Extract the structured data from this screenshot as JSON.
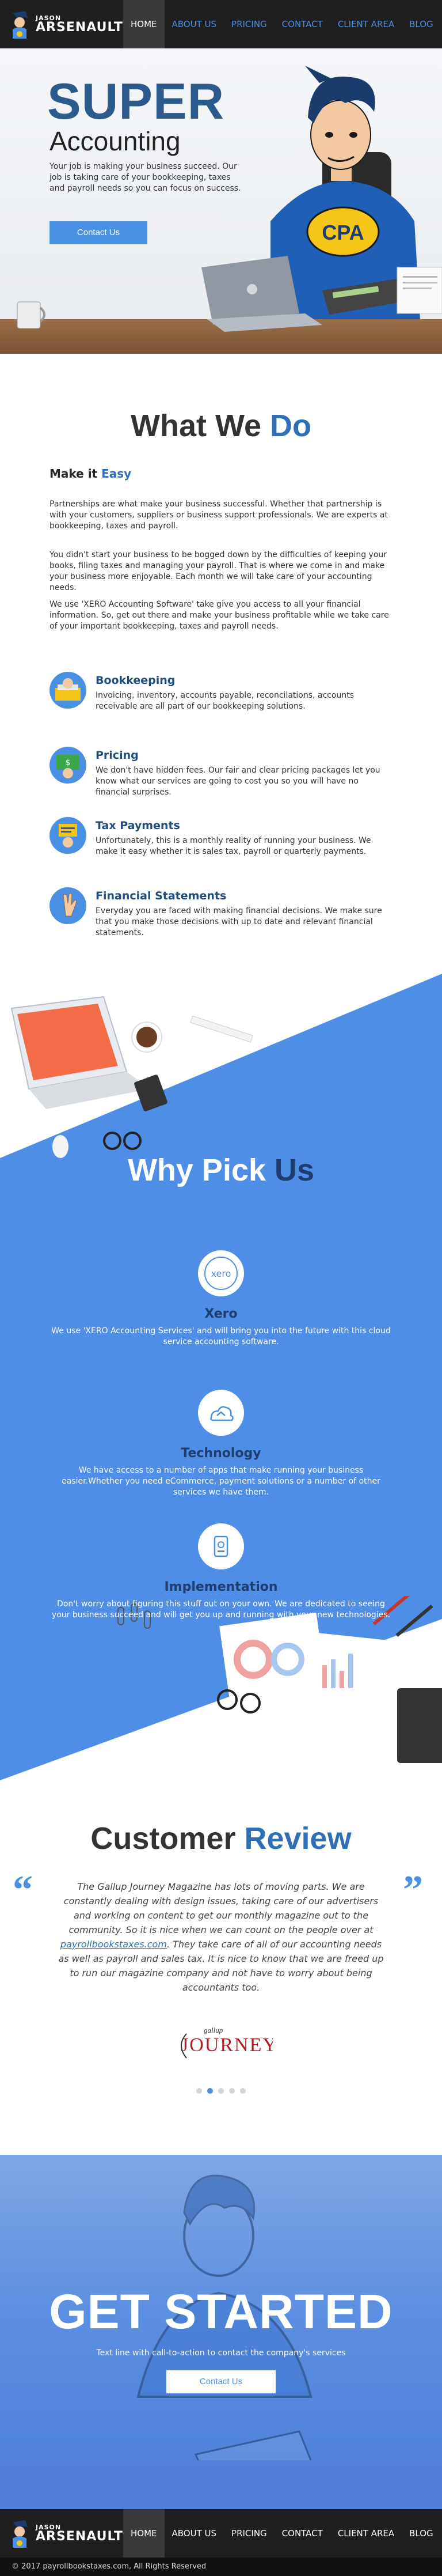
{
  "brand": {
    "line1": "JASON",
    "line2": "ARSENAULT"
  },
  "nav": {
    "items": [
      {
        "label": "HOME",
        "active": true
      },
      {
        "label": "ABOUT US",
        "active": false
      },
      {
        "label": "PRICING",
        "active": false
      },
      {
        "label": "CONTACT",
        "active": false
      },
      {
        "label": "CLIENT AREA",
        "active": false
      },
      {
        "label": "BLOG",
        "active": false
      }
    ]
  },
  "hero": {
    "title": "SUPER",
    "subtitle": "Accounting",
    "text": "Your job is making your business succeed. Our job is taking care of your bookkeeping, taxes and payroll needs so you can focus on success.",
    "cta": "Contact Us",
    "badge": "CPA"
  },
  "what_we_do": {
    "title_a": "What We ",
    "title_b": "Do",
    "sub_a": "Make it ",
    "sub_b": "Easy",
    "paragraphs": [
      "Partnerships are what make your business successful. Whether that partnership is with your customers, suppliers or business support professionals. We are experts at bookkeeping, taxes and payroll.",
      "You didn't start your business to be bogged down by the difficulties of keeping your books, filing taxes and managing your payroll. That is where we come in and make your business more enjoyable. Each month we will take care of your accounting needs.",
      "We use 'XERO Accounting Software' take give you access to all your financial information. So, get out there and make your business profitable while we take care of your important bookkeeping, taxes and payroll needs."
    ],
    "services": [
      {
        "title": "Bookkeeping",
        "text": "Invoicing, inventory, accounts payable, reconcilations, accounts receivable are all part of our bookkeeping solutions."
      },
      {
        "title": "Pricing",
        "text": "We don't have hidden fees. Our fair and clear pricing packages let you know what our services are going to cost you so you will have no financial surprises."
      },
      {
        "title": "Tax Payments",
        "text": "Unfortunately, this is a monthly reality of running your business. We make it easy whether it is sales tax, payroll or quarterly payments."
      },
      {
        "title": "Financial Statements",
        "text": "Everyday you are faced with making financial decisions. We make sure that you make those decisions with up to date and relevant financial statements."
      }
    ]
  },
  "why_pick_us": {
    "title_a": "Why Pick ",
    "title_b": "Us",
    "items": [
      {
        "title": "Xero",
        "text": "We use 'XERO Accounting Services' and will bring you into the future with this cloud service accounting software.",
        "icon_label": "xero"
      },
      {
        "title": "Technology",
        "text": "We have access to a number of apps that make running your business easier.Whether you need eCommerce, payment solutions or a number of other services we have them."
      },
      {
        "title": "Implementation",
        "text": "Don't worry about figuring this stuff out on your own. We are dedicated to seeing your business succeed and will get you up and running with your new technologies."
      }
    ]
  },
  "review": {
    "title_a": "Customer ",
    "title_b": "Review",
    "text_before": "The Gallup Journey Magazine has lots of moving parts. We are constantly dealing with design issues, taking care of our advertisers and working on content to get our monthly magazine out to the community. So it is nice when we can count on the people over at ",
    "link": "payrollbookstaxes.com",
    "text_after": ". They take care of all of our accounting needs as well as payroll and sales tax. It is nice to know that we are freed up to run our magazine company and not have to worry about being accountants too.",
    "logo_small": "gallup",
    "logo_big": "JOURNEY",
    "dot_count": 5,
    "active_dot": 1
  },
  "cta": {
    "title": "GET STARTED",
    "subtitle": "Text line with call-to-action to contact the company's services",
    "button": "Contact Us"
  },
  "footer": {
    "copyright": "© 2017 payrollbookstaxes.com, All Rights Reserved"
  },
  "colors": {
    "primary": "#4a90e2",
    "dark_blue": "#2b5a8c",
    "nav_bg": "#1f1f1f",
    "why_bg": "#4f8ee6"
  }
}
